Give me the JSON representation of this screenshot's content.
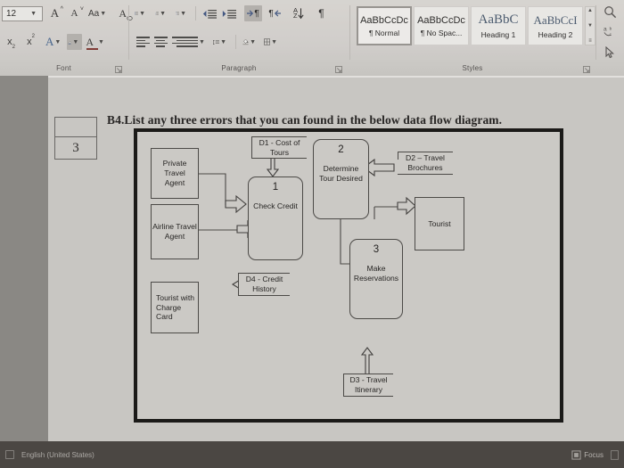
{
  "app": {
    "status_left": "English (United States)",
    "status_right": "Focus"
  },
  "ribbon": {
    "groups": [
      {
        "name": "Font",
        "label": "Font"
      },
      {
        "name": "Paragraph",
        "label": "Paragraph"
      },
      {
        "name": "Styles",
        "label": "Styles"
      }
    ],
    "font": {
      "size_value": "12",
      "grow_font": "A",
      "shrink_font": "A",
      "change_case": "Aa",
      "clear_formatting": "A",
      "subscript": "x",
      "subscript_sub": "2",
      "superscript": "x",
      "superscript_sup": "2",
      "text_effects": "A",
      "highlight": "",
      "font_color": "A"
    },
    "paragraph": {
      "show_marks": "¶",
      "ltr_mark": "¶",
      "rtl_mark": "¶",
      "sort_a": "A",
      "sort_z": "Z"
    },
    "styles": {
      "tiles": [
        {
          "sample": "AaBbCcDc",
          "name": "¶ Normal",
          "serif": false,
          "size": 11,
          "active": true
        },
        {
          "sample": "AaBbCcDc",
          "name": "¶ No Spac...",
          "serif": false,
          "size": 11,
          "active": false
        },
        {
          "sample": "AaBbC",
          "name": "Heading 1",
          "serif": true,
          "size": 15,
          "active": false
        },
        {
          "sample": "AaBbCcI",
          "name": "Heading 2",
          "serif": true,
          "size": 13,
          "active": false
        }
      ],
      "scroll_up": "▲",
      "scroll_down": "▼",
      "scroll_more": "≡"
    },
    "editing_icons": [
      "find-icon",
      "replace-icon",
      "select-icon"
    ],
    "dialog_launcher": "↘"
  },
  "document": {
    "marks_cell_top": "",
    "marks_cell_bottom": "3",
    "question": "B4.List any three errors that you can found in the below data flow diagram."
  },
  "diagram": {
    "title": "Travel agency data flow diagram",
    "entities": [
      {
        "id": "private-travel-agent",
        "label": "Private Travel\nAgent",
        "align": "center"
      },
      {
        "id": "airline-travel-agent",
        "label": "Airline Travel\nAgent",
        "align": "center"
      },
      {
        "id": "tourist-with-charge-card",
        "label": "Tourist with\nCharge\nCard",
        "align": "left"
      },
      {
        "id": "tourist",
        "label": "Tourist",
        "align": "center"
      }
    ],
    "processes": [
      {
        "id": "check-credit",
        "number": "1",
        "label": "Check Credit"
      },
      {
        "id": "determine-tour-desired",
        "number": "2",
        "label": "Determine\nTour Desired"
      },
      {
        "id": "make-reservations",
        "number": "3",
        "label": "Make\nReservations"
      }
    ],
    "datastores": [
      {
        "id": "d1",
        "label": "D1 - Cost of\nTours"
      },
      {
        "id": "d2",
        "label": "D2 – Travel\nBrochures"
      },
      {
        "id": "d3",
        "label": "D3 - Travel\nItinerary"
      },
      {
        "id": "d4",
        "label": "D4 - Credit\nHistory"
      }
    ],
    "flows": [
      {
        "from": "private-travel-agent",
        "to": "check-credit",
        "style": "block-arrow"
      },
      {
        "from": "airline-travel-agent",
        "to": "check-credit",
        "style": "block-arrow"
      },
      {
        "from": "d1",
        "to": "check-credit",
        "style": "block-arrow-down"
      },
      {
        "from": "determine-tour-desired",
        "to": "d2",
        "style": "double-block-arrow"
      },
      {
        "from": "determine-tour-desired",
        "to": "make-reservations",
        "style": "block-arrow"
      },
      {
        "from": "make-reservations",
        "to": "tourist",
        "style": "block-arrow"
      },
      {
        "from": "d3",
        "to": "make-reservations",
        "style": "block-arrow-up"
      },
      {
        "from": "d4",
        "to": "tourist-with-charge-card",
        "style": "block-arrow-left"
      }
    ]
  }
}
